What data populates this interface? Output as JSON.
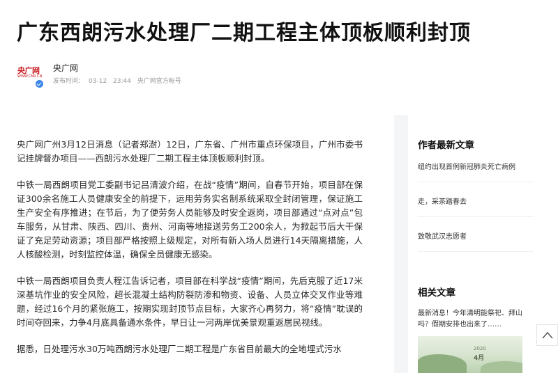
{
  "article": {
    "title": "广东西朗污水处理厂二期工程主体顶板顺利封顶",
    "author": "央广网",
    "publish_label": "发布时间：",
    "publish_date": "03-12",
    "publish_time": "23:44",
    "account": "央广网官方帐号",
    "paragraphs": [
      "央广网广州3月12日消息（记者郑澍）12日，广东省、广州市重点环保项目，广州市委书记挂牌督办项目——西朗污水处理厂二期工程主体顶板顺利封顶。",
      "中铁一局西朗项目党工委副书记吕清波介绍，在战“疫情”期间，自春节开始，项目部在保证300余名施工人员健康安全的前提下，运用劳务实名制系统采取全封闭管理，保证施工生产安全有序推进；在节后，为了便劳务人员能够及时安全返岗，项目部通过“点对点”包车服务，从甘肃、陕西、四川、贵州、河南等地接送劳务工200余人，为掀起节后大干保证了充足劳动资源；项目部严格按照上级规定，对所有新入场人员进行14天隔离措施，人人核酸检测，时刻监控体温，确保全员健康无感染。",
      "中铁一局西朗项目负责人程江告诉记者，项目部在科学战“疫情”期间，先后克服了近17米深基坑作业的安全风险，超长混凝土结构防裂防渗和物资、设备、人员立体交叉作业等难题，经过16个月的紧张施工，按期实现封顶节点目标，大家齐心再努力，将“疫情”耽误的时间夺回来，力争4月底具备通水条件，早日让一河两岸优美景观重返居民视线。",
      "据悉，日处理污水30万吨西朗污水处理厂二期工程是广东省目前最大的全地埋式污水"
    ]
  },
  "logo": {
    "text": "央广网",
    "sub": "WWW.CNR.CN"
  },
  "sidebar": {
    "author_latest_title": "作者最新文章",
    "author_latest": [
      "纽约出现首例新冠肺炎死亡病例",
      "走，采茶踏春去",
      "致敬武汉志愿者"
    ],
    "related_title": "相关文章",
    "related_text": "最新消息！今年清明能祭祀、拜山吗？假期安排也出来了……",
    "related_img_year": "2020",
    "related_img_month": "4月"
  },
  "colors": {
    "brand_red": "#c8161d",
    "verified_blue": "#3a86e8"
  },
  "icons": {
    "back_to_top": "chevron-up-icon",
    "verified": "verified-check-icon"
  }
}
